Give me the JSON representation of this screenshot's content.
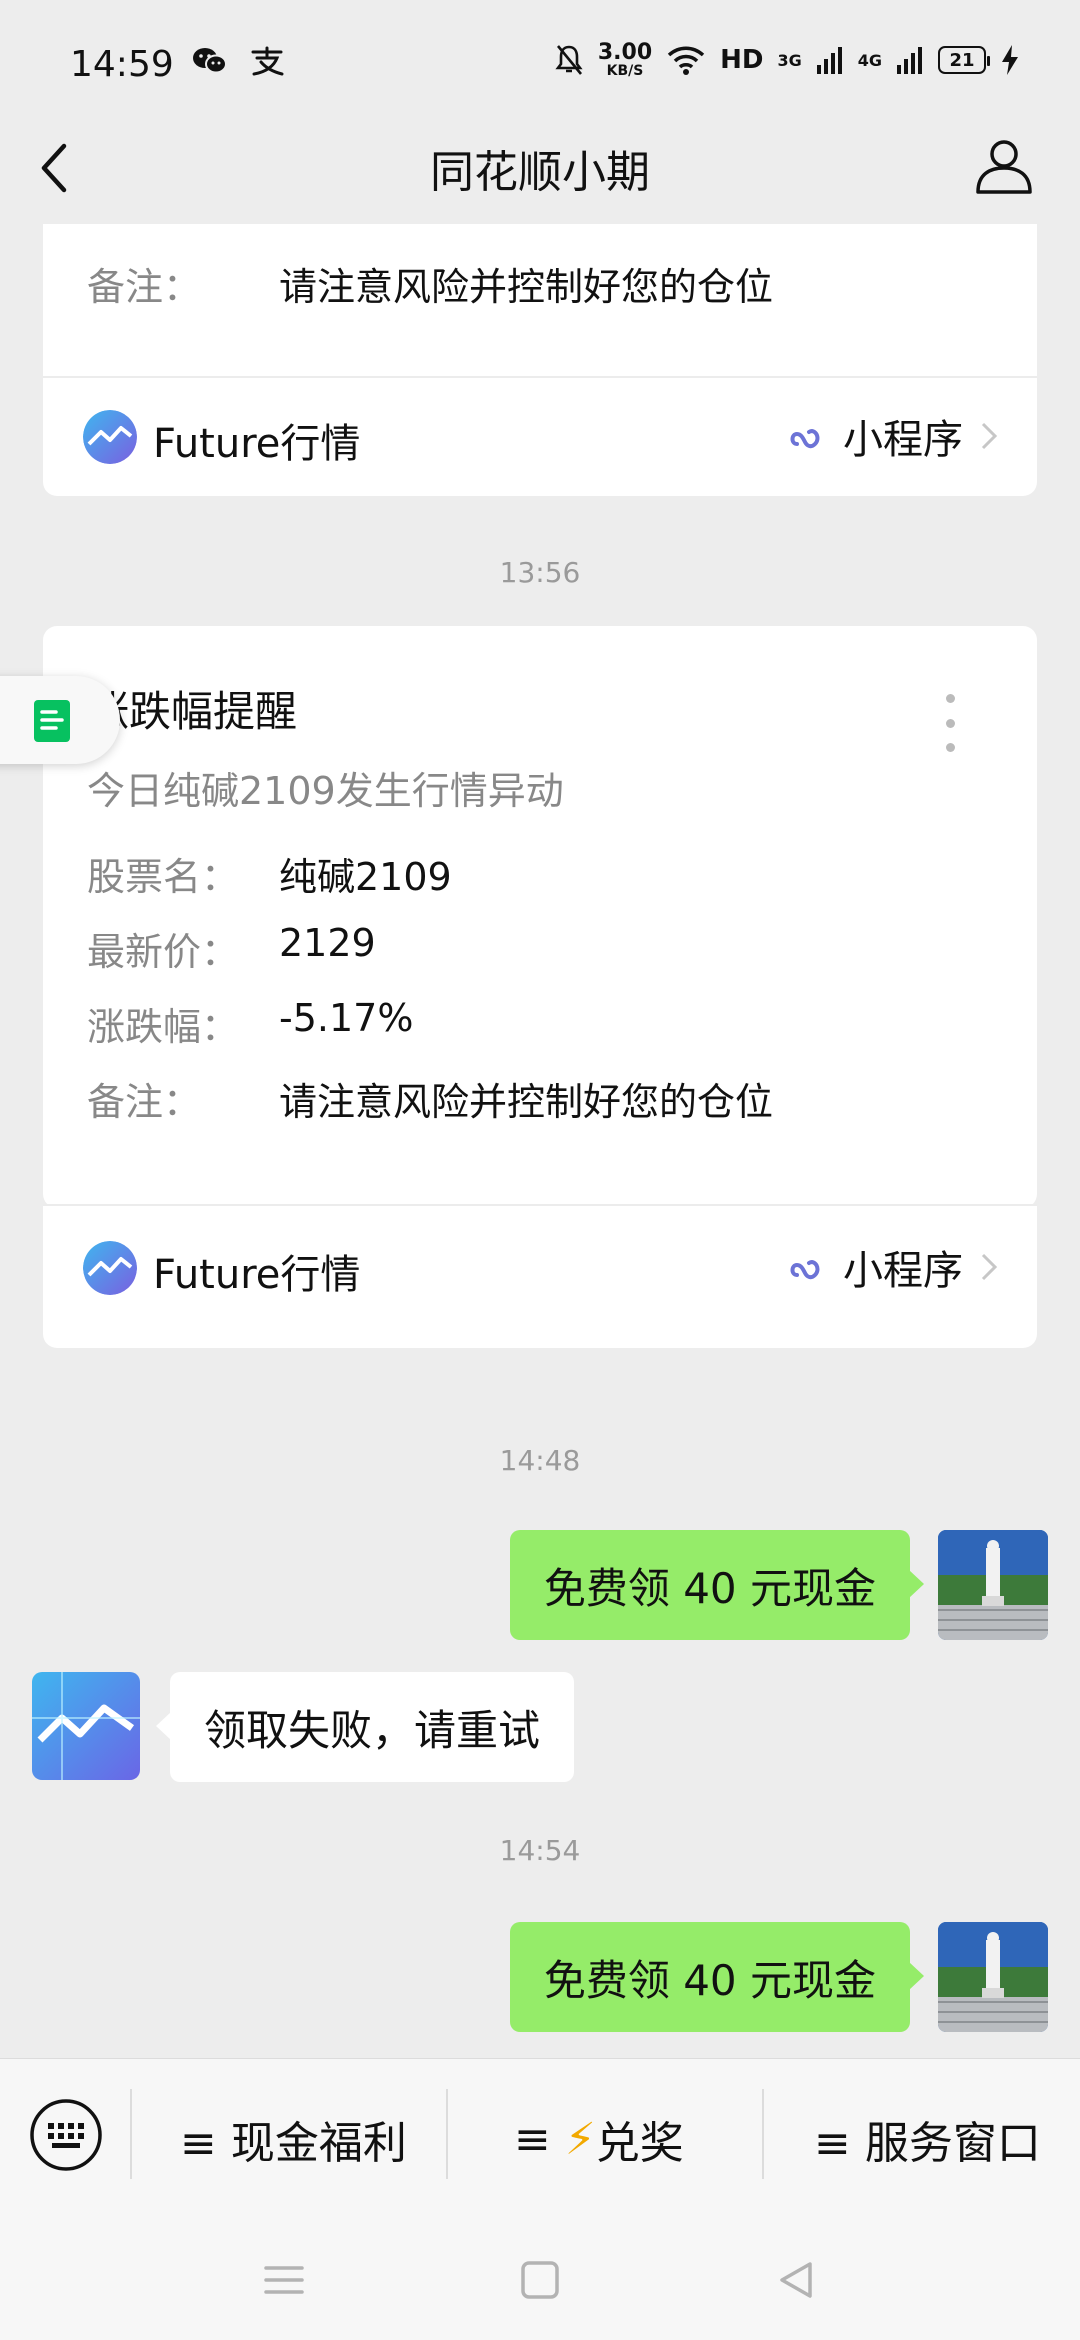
{
  "status_bar": {
    "time": "14:59",
    "speed_value": "3.00",
    "speed_unit": "KB/S",
    "hd": "HD",
    "net1": "3G",
    "net2": "4G",
    "battery": "21"
  },
  "nav": {
    "title": "同花顺小期"
  },
  "cards": [
    {
      "fields": [
        {
          "label": "备注：",
          "value": "请注意风险并控制好您的仓位"
        }
      ],
      "footer_name": "Future行情",
      "footer_mp": "小程序"
    },
    {
      "title": "涨跌幅提醒",
      "desc": "今日纯碱2109发生行情异动",
      "fields": [
        {
          "label": "股票名：",
          "value": "纯碱2109"
        },
        {
          "label": "最新价：",
          "value": "2129"
        },
        {
          "label": "涨跌幅：",
          "value": "-5.17%"
        },
        {
          "label": "备注：",
          "value": "请注意风险并控制好您的仓位"
        }
      ],
      "footer_name": "Future行情",
      "footer_mp": "小程序"
    }
  ],
  "timestamps": [
    "13:56",
    "14:48",
    "14:54"
  ],
  "messages": [
    {
      "side": "right",
      "text": "免费领 40 元现金"
    },
    {
      "side": "left",
      "text": "领取失败，请重试"
    },
    {
      "side": "right",
      "text": "免费领 40 元现金"
    }
  ],
  "bottom_menu": {
    "item1": "≡ 现金福利",
    "item2_prefix": "≡",
    "item2_icon": "⚡",
    "item2_label": "兑奖",
    "item3": "≡ 服务窗口"
  },
  "colors": {
    "accent_green": "#95ec69",
    "file_green": "#07c160",
    "background": "#ededed"
  }
}
